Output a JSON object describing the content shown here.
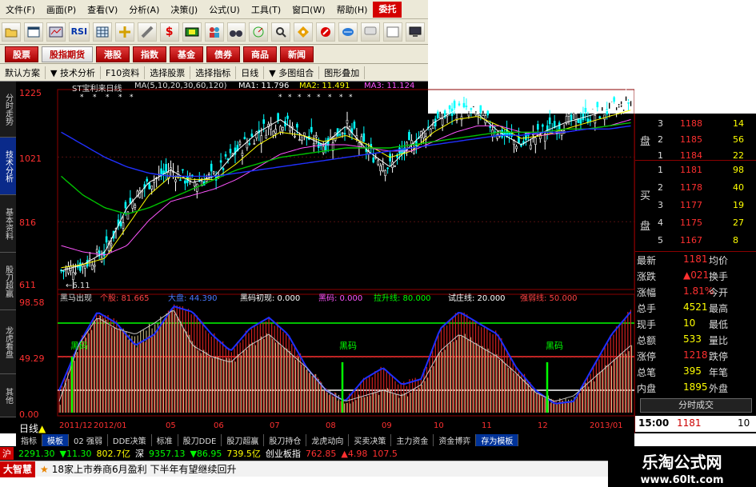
{
  "menu": [
    "文件(F)",
    "画面(P)",
    "查看(V)",
    "分析(A)",
    "决策(J)",
    "公式(U)",
    "工具(T)",
    "窗口(W)",
    "帮助(H)",
    "委托"
  ],
  "toolbar_icons": [
    "folder-icon",
    "window-icon",
    "kline-icon",
    "RSI",
    "grid-icon",
    "crosshair-icon",
    "ruler-icon",
    "dollar-icon",
    "film-icon",
    "people-icon",
    "binoculars-icon",
    "radar-icon",
    "search-icon",
    "diamond-icon",
    "gem-icon",
    "globe-icon",
    "speech-icon",
    "chart-icon",
    "monitor-icon"
  ],
  "toolbar_rsi": "RSI",
  "toolbar_dollar": "$",
  "categories": [
    "股票",
    "股指期货",
    "港股",
    "指数",
    "基金",
    "债券",
    "商品",
    "新闻"
  ],
  "subbar": [
    "默认方案",
    "▼ 技术分析",
    "F10资料",
    "选择股票",
    "选择指标",
    "日线",
    "▼ 多图组合",
    "图形叠加"
  ],
  "left_tabs": [
    "分时走势",
    "技术分析",
    "基本资料",
    "股刀超赢",
    "龙虎看盘",
    "其他"
  ],
  "chart": {
    "title": "ST宝利来日线",
    "ma_label": "MA(5,10,20,30,60,120)",
    "ma1": "MA1: 11.796",
    "ma2": "MA2: 11.491",
    "ma3": "MA3: 11.124",
    "price_ticks": [
      "1225",
      "1021",
      "816",
      "611"
    ],
    "low_label": "←6.11",
    "ind_name": "黑马出现",
    "ind_values": [
      "个股: 81.665",
      "大盘: 44.390",
      "黑码初现: 0.000",
      "黑码: 0.000",
      "拉升线: 80.000",
      "试庄线: 20.000",
      "强弱线: 50.000"
    ],
    "ind_ticks": [
      "98.58",
      "49.29",
      "0.00"
    ],
    "heima_labels": [
      "黑码",
      "黑码",
      "黑码"
    ],
    "date_labels": [
      "2011/12",
      "2012/01",
      "05",
      "06",
      "07",
      "08",
      "09",
      "10",
      "11",
      "12",
      "2013/01"
    ],
    "period": "日线"
  },
  "chart_data": {
    "type": "line",
    "title": "ST宝利来日线",
    "ylim": [
      6.11,
      12.25
    ],
    "series": [
      {
        "name": "MA1",
        "values": [
          6.6,
          6.8,
          7.2,
          8.6,
          9.4,
          9.8,
          9.4,
          9.6,
          10.4,
          11.0,
          11.4,
          10.9,
          10.6,
          11.2,
          10.4,
          9.9,
          10.6,
          11.3,
          11.7,
          11.6,
          11.0,
          10.6,
          11.0,
          11.3,
          11.5,
          11.7,
          12.0
        ]
      },
      {
        "name": "MA2",
        "values": [
          6.7,
          6.8,
          7.0,
          8.0,
          9.0,
          9.6,
          9.5,
          9.5,
          10.0,
          10.6,
          11.0,
          10.9,
          10.7,
          10.9,
          10.6,
          10.2,
          10.4,
          11.0,
          11.4,
          11.5,
          11.2,
          10.8,
          10.9,
          11.1,
          11.3,
          11.5,
          11.7
        ]
      },
      {
        "name": "MA3",
        "values": [
          7.4,
          7.2,
          7.1,
          7.4,
          8.2,
          8.8,
          9.0,
          9.2,
          9.5,
          9.9,
          10.3,
          10.5,
          10.6,
          10.6,
          10.5,
          10.4,
          10.4,
          10.7,
          11.0,
          11.2,
          11.2,
          11.0,
          10.9,
          11.0,
          11.1,
          11.2,
          11.4
        ]
      }
    ]
  },
  "quote": {
    "sell_label": "盘",
    "buy_label1": "买",
    "buy_label2": "盘",
    "sell": [
      [
        "3",
        "1188",
        "14"
      ],
      [
        "2",
        "1185",
        "56"
      ],
      [
        "1",
        "1184",
        "22"
      ]
    ],
    "buy": [
      [
        "1",
        "1181",
        "98"
      ],
      [
        "2",
        "1178",
        "40"
      ],
      [
        "3",
        "1177",
        "19"
      ],
      [
        "4",
        "1175",
        "27"
      ],
      [
        "5",
        "1167",
        "8"
      ]
    ],
    "stats": [
      [
        "最新",
        "1181",
        "均价",
        ""
      ],
      [
        "涨跌",
        "▲021",
        "换手",
        ""
      ],
      [
        "涨幅",
        "1.81%",
        "今开",
        ""
      ],
      [
        "总手",
        "4521",
        "最高",
        ""
      ],
      [
        "现手",
        "10",
        "最低",
        ""
      ],
      [
        "总额",
        "533",
        "量比",
        ""
      ],
      [
        "涨停",
        "1218",
        "跌停",
        ""
      ],
      [
        "总笔",
        "395",
        "年笔",
        ""
      ],
      [
        "内盘",
        "1895",
        "外盘",
        ""
      ]
    ],
    "tick_button": "分时成交",
    "tick_time": "15:00",
    "tick_price": "1181",
    "tick_vol": "10"
  },
  "bottom_tabs": [
    "指标",
    "模板",
    "02 强弱",
    "DDE决策",
    "标准",
    "股刀DDE",
    "股刀超赢",
    "股刀持仓",
    "龙虎动向",
    "买卖决策",
    "主力资金",
    "资金博弈",
    "存为模板"
  ],
  "ticker": {
    "sh_label": "沪",
    "sh_index": "2291.30",
    "sh_change": "▼11.30",
    "sh_amount": "802.7亿",
    "sz_label": "深",
    "sz_index": "9357.13",
    "sz_change": "▼86.95",
    "sz_amount": "739.5亿",
    "board_label": "创业板指",
    "board_index": "762.85",
    "board_change": "▲4.98",
    "extra": "107.5"
  },
  "news": {
    "logo": "大智慧",
    "star": "★",
    "text": "18家上市券商6月盈利  下半年有望继续回升"
  },
  "brand": {
    "name": "乐淘公式网",
    "url": "www.60lt.com"
  },
  "colors": {
    "bg": "#000000",
    "up": "#ff3030",
    "down": "#00ff00",
    "yellow": "#ffff00",
    "cyan": "#00ffff",
    "blue": "#1f2fff",
    "magenta": "#ff00ff"
  }
}
